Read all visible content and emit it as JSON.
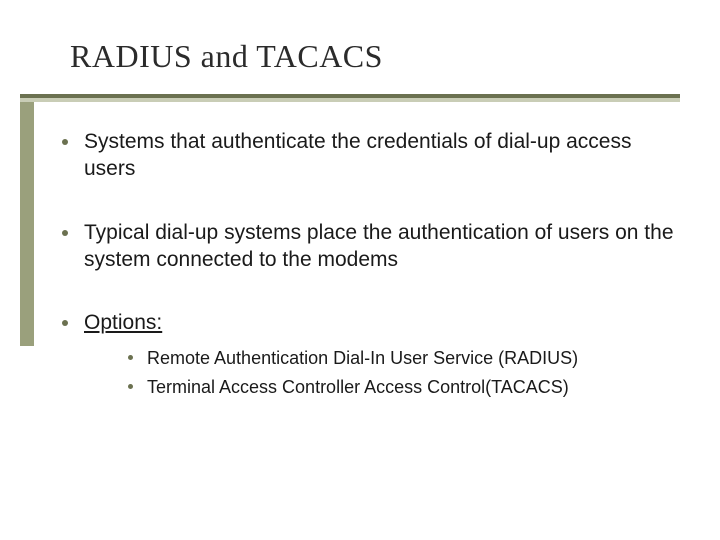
{
  "title": "RADIUS and TACACS",
  "bullets": [
    "Systems that authenticate the credentials of dial-up access users",
    "Typical dial-up systems place the authentication of users on the system connected to the modems"
  ],
  "options_label": "Options:",
  "options_items": [
    "Remote Authentication Dial-In User Service (RADIUS)",
    "Terminal Access Controller Access Control(TACACS)"
  ]
}
